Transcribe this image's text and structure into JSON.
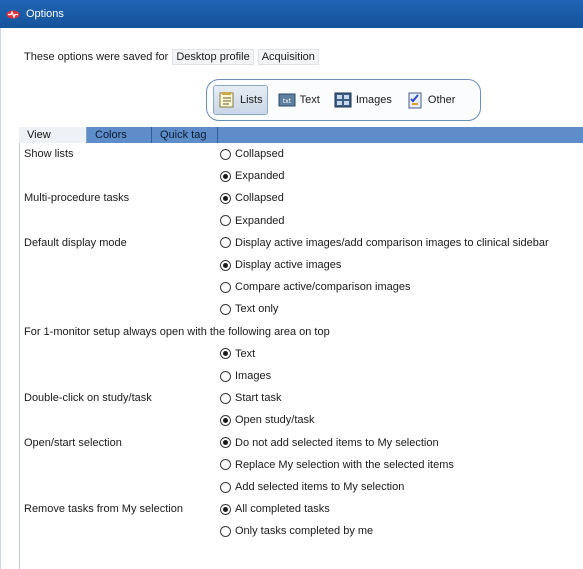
{
  "window": {
    "title": "Options"
  },
  "saved": {
    "label": "These options were saved for",
    "profile": "Desktop profile",
    "context": "Acquisition"
  },
  "segments": [
    {
      "label": "Lists",
      "icon": "lists-icon",
      "active": true
    },
    {
      "label": "Text",
      "icon": "text-icon",
      "active": false
    },
    {
      "label": "Images",
      "icon": "images-icon",
      "active": false
    },
    {
      "label": "Other",
      "icon": "other-icon",
      "active": false
    }
  ],
  "tabs": [
    {
      "label": "View",
      "active": true
    },
    {
      "label": "Colors",
      "active": false
    },
    {
      "label": "Quick tag",
      "active": false
    }
  ],
  "settings": [
    {
      "label": "Show lists",
      "options": [
        {
          "text": "Collapsed",
          "checked": false
        },
        {
          "text": "Expanded",
          "checked": true
        }
      ]
    },
    {
      "label": "Multi-procedure tasks",
      "options": [
        {
          "text": "Collapsed",
          "checked": true
        },
        {
          "text": "Expanded",
          "checked": false
        }
      ]
    },
    {
      "label": "Default display mode",
      "options": [
        {
          "text": "Display active images/add comparison images to clinical sidebar",
          "checked": false
        },
        {
          "text": "Display active images",
          "checked": true
        },
        {
          "text": "Compare active/comparison images",
          "checked": false
        },
        {
          "text": "Text only",
          "checked": false
        }
      ]
    },
    {
      "label": "For 1-monitor setup always open with the following area on top",
      "options": [
        {
          "text": "Text",
          "checked": true
        },
        {
          "text": "Images",
          "checked": false
        }
      ]
    },
    {
      "label": "Double-click on study/task",
      "options": [
        {
          "text": "Start task",
          "checked": false
        },
        {
          "text": "Open study/task",
          "checked": true
        }
      ]
    },
    {
      "label": "Open/start selection",
      "options": [
        {
          "text": "Do not add selected items to My selection",
          "checked": true
        },
        {
          "text": "Replace My selection with the selected items",
          "checked": false
        },
        {
          "text": "Add selected items to My selection",
          "checked": false
        }
      ]
    },
    {
      "label": "Remove tasks from My selection",
      "options": [
        {
          "text": "All completed tasks",
          "checked": true
        },
        {
          "text": "Only tasks completed by me",
          "checked": false
        }
      ]
    }
  ],
  "colors": {
    "titlebar": "#1f64b4",
    "tabstrip": "#5e8dc9",
    "app_icon": "#e0303a"
  }
}
